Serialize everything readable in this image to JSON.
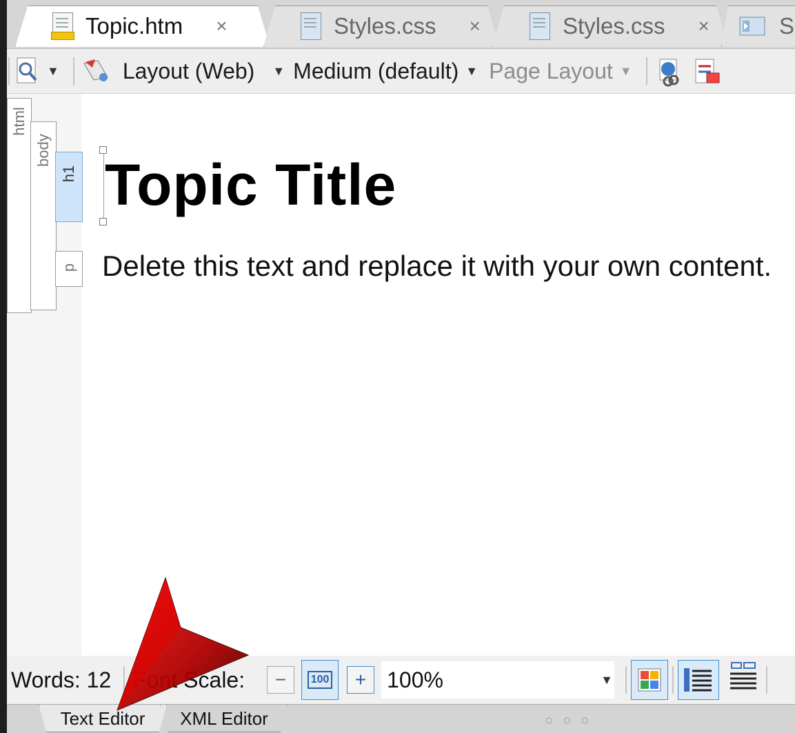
{
  "tabs": [
    {
      "label": "Topic.htm",
      "active": true,
      "icon": "html-file-icon",
      "close": "×"
    },
    {
      "label": "Styles.css",
      "active": false,
      "icon": "css-file-icon",
      "close": "×"
    },
    {
      "label": "Styles.css",
      "active": false,
      "icon": "css-file-icon",
      "close": "×"
    },
    {
      "label": "S",
      "active": false,
      "icon": "skin-file-icon"
    }
  ],
  "toolbar": {
    "layout_label": "Layout (Web)",
    "medium_label": "Medium (default)",
    "page_layout_label": "Page Layout",
    "dropdown_glyph": "▼"
  },
  "structure_bars": {
    "html": "html",
    "body": "body",
    "h1": "h1",
    "p": "p"
  },
  "document": {
    "title": "Topic Title",
    "paragraph": "Delete this text and replace it with your own content."
  },
  "statusbar": {
    "words": "Words: 12",
    "font_scale_label": "Font Scale:",
    "minus": "−",
    "reset": "100",
    "plus": "+",
    "zoom_value": "100%"
  },
  "bottom_tabs": [
    {
      "label": "Text Editor",
      "active": true
    },
    {
      "label": "XML Editor",
      "active": false
    }
  ],
  "colors": {
    "selection_bar": "#cde4fb",
    "annotation_arrow": "#c00000"
  }
}
